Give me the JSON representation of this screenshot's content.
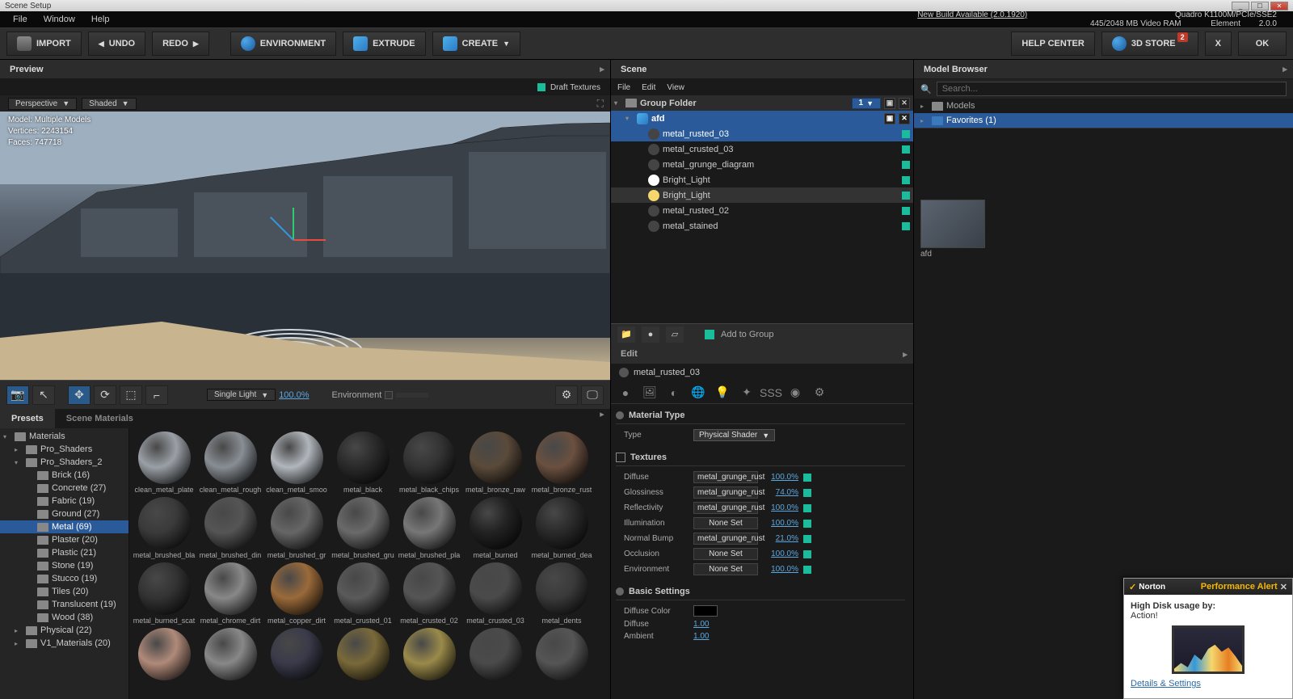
{
  "window": {
    "title": "Scene Setup",
    "app_name": "Element",
    "version": "2.0.0",
    "gpu_info": "Quadro K1100M/PCIe/SSE2",
    "vram_info": "445/2048 MB Video RAM",
    "new_build": "New Build Available (2.0.1920)"
  },
  "menubar": {
    "items": [
      "File",
      "Window",
      "Help"
    ]
  },
  "toolbar": {
    "import": "IMPORT",
    "undo": "UNDO",
    "redo": "REDO",
    "environment": "ENVIRONMENT",
    "extrude": "EXTRUDE",
    "create": "CREATE",
    "help_center": "HELP CENTER",
    "store": "3D STORE",
    "store_badge": "2",
    "x": "X",
    "ok": "OK"
  },
  "preview": {
    "title": "Preview",
    "draft_textures": "Draft Textures",
    "perspective": "Perspective",
    "shaded": "Shaded",
    "stats": {
      "model_label": "Model:",
      "model": "Multiple Models",
      "vertices_label": "Vertices:",
      "vertices": "2243154",
      "faces_label": "Faces:",
      "faces": "747718"
    },
    "single_light": "Single Light",
    "opacity": "100.0%",
    "env_label": "Environment"
  },
  "presets": {
    "tab_presets": "Presets",
    "tab_materials": "Scene Materials",
    "tree": [
      {
        "label": "Materials",
        "indent": 0,
        "arrow": "▾"
      },
      {
        "label": "Pro_Shaders",
        "indent": 1,
        "arrow": "▸"
      },
      {
        "label": "Pro_Shaders_2",
        "indent": 1,
        "arrow": "▾"
      },
      {
        "label": "Brick (16)",
        "indent": 2
      },
      {
        "label": "Concrete (27)",
        "indent": 2
      },
      {
        "label": "Fabric (19)",
        "indent": 2
      },
      {
        "label": "Ground (27)",
        "indent": 2
      },
      {
        "label": "Metal (69)",
        "indent": 2,
        "selected": true
      },
      {
        "label": "Plaster (20)",
        "indent": 2
      },
      {
        "label": "Plastic (21)",
        "indent": 2
      },
      {
        "label": "Stone (19)",
        "indent": 2
      },
      {
        "label": "Stucco (19)",
        "indent": 2
      },
      {
        "label": "Tiles (20)",
        "indent": 2
      },
      {
        "label": "Translucent (19)",
        "indent": 2
      },
      {
        "label": "Wood (38)",
        "indent": 2
      },
      {
        "label": "Physical (22)",
        "indent": 1,
        "arrow": "▸"
      },
      {
        "label": "V1_Materials (20)",
        "indent": 1,
        "arrow": "▸"
      }
    ],
    "grid": [
      [
        "clean_metal_plate",
        "clean_metal_rough",
        "clean_metal_smoo",
        "metal_black",
        "metal_black_chips",
        "metal_bronze_raw",
        "metal_bronze_rust"
      ],
      [
        "metal_brushed_bla",
        "metal_brushed_din",
        "metal_brushed_gr",
        "metal_brushed_gru",
        "metal_brushed_pla",
        "metal_burned",
        "metal_burned_dea"
      ],
      [
        "metal_burned_scat",
        "metal_chrome_dirt",
        "metal_copper_dirt",
        "metal_crusted_01",
        "metal_crusted_02",
        "metal_crusted_03",
        "metal_dents"
      ],
      [
        "",
        "",
        "",
        "",
        "",
        "",
        ""
      ]
    ]
  },
  "scene": {
    "title": "Scene",
    "menu": [
      "File",
      "Edit",
      "View"
    ],
    "group_folder": "Group Folder",
    "group_num": "1",
    "group_name": "afd",
    "items": [
      {
        "label": "metal_rusted_03",
        "selected": true,
        "type": "sphere"
      },
      {
        "label": "metal_crusted_03",
        "type": "sphere"
      },
      {
        "label": "metal_grunge_diagram",
        "type": "sphere"
      },
      {
        "label": "Bright_Light",
        "type": "light-white"
      },
      {
        "label": "Bright_Light",
        "type": "light-yellow",
        "hover": true
      },
      {
        "label": "metal_rusted_02",
        "type": "sphere"
      },
      {
        "label": "metal_stained",
        "type": "sphere"
      }
    ],
    "add_to_group": "Add to Group"
  },
  "edit": {
    "title": "Edit",
    "object_name": "metal_rusted_03",
    "material_type": "Material Type",
    "type_label": "Type",
    "type_value": "Physical Shader",
    "textures": "Textures",
    "texture_rows": [
      {
        "label": "Diffuse",
        "value": "metal_grunge_rust",
        "pct": "100.0%"
      },
      {
        "label": "Glossiness",
        "value": "metal_grunge_rust",
        "pct": "74.0%"
      },
      {
        "label": "Reflectivity",
        "value": "metal_grunge_rust",
        "pct": "100.0%"
      },
      {
        "label": "Illumination",
        "value": "None Set",
        "pct": "100.0%"
      },
      {
        "label": "Normal Bump",
        "value": "metal_grunge_rust",
        "pct": "21.0%"
      },
      {
        "label": "Occlusion",
        "value": "None Set",
        "pct": "100.0%"
      },
      {
        "label": "Environment",
        "value": "None Set",
        "pct": "100.0%"
      }
    ],
    "basic_settings": "Basic Settings",
    "diffuse_color": "Diffuse Color",
    "diffuse": "Diffuse",
    "diffuse_val": "1.00",
    "ambient": "Ambient",
    "ambient_val": "1.00"
  },
  "browser": {
    "title": "Model Browser",
    "search_placeholder": "Search...",
    "models": "Models",
    "favorites": "Favorites (1)",
    "thumb_label": "afd"
  },
  "notification": {
    "brand": "Norton",
    "title": "Performance Alert",
    "heading": "High Disk usage by:",
    "process": "Action!",
    "link": "Details & Settings"
  }
}
